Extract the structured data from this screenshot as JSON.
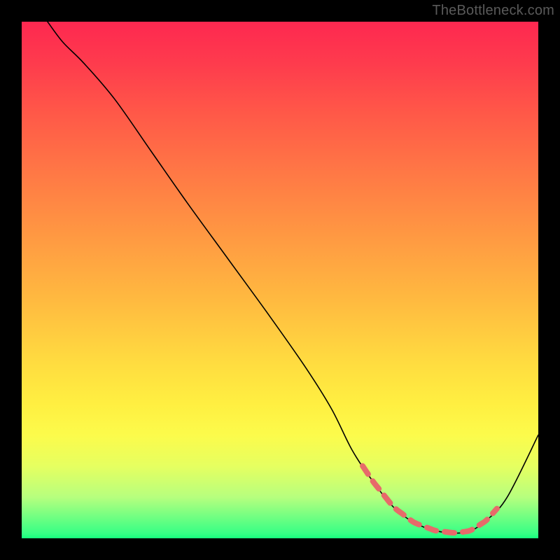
{
  "watermark": "TheBottleneck.com",
  "chart_data": {
    "type": "line",
    "title": "",
    "xlabel": "",
    "ylabel": "",
    "xlim": [
      0,
      100
    ],
    "ylim": [
      0,
      100
    ],
    "series": [
      {
        "name": "bottleneck-curve",
        "x": [
          5,
          8,
          12,
          18,
          25,
          32,
          40,
          48,
          55,
          60,
          64,
          68,
          72,
          76,
          80,
          84,
          87,
          90,
          94,
          100
        ],
        "y": [
          100,
          96,
          92,
          85,
          75,
          65,
          54,
          43,
          33,
          25,
          17,
          11,
          6,
          3,
          1.5,
          1,
          1.5,
          3.5,
          8,
          20
        ]
      }
    ],
    "low_region": {
      "x_start": 66,
      "x_end": 92
    },
    "colors": {
      "curve": "#000000",
      "highlight": "#e76a6a",
      "gradient_top": "#fe2850",
      "gradient_bottom": "#17ff7e",
      "frame": "#000000"
    }
  }
}
